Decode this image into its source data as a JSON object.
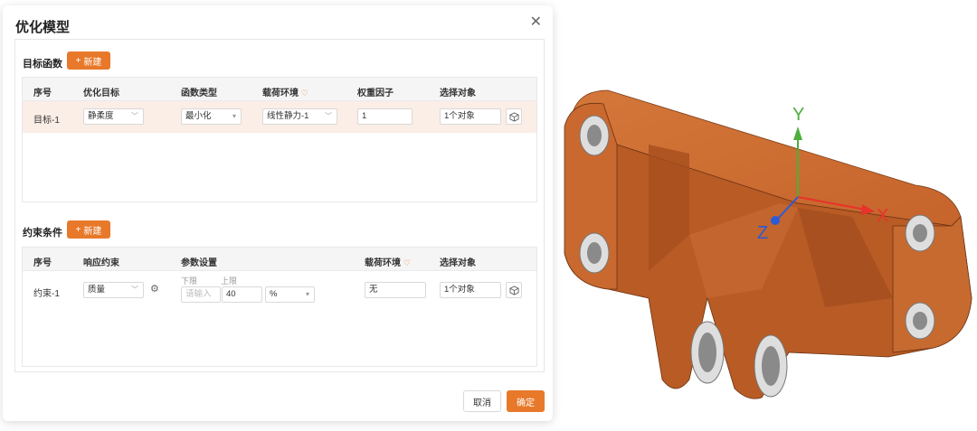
{
  "dialog": {
    "title": "优化模型",
    "close_icon": "close-icon"
  },
  "objective": {
    "section_label": "目标函数",
    "new_label": "新建",
    "headers": {
      "index": "序号",
      "target": "优化目标",
      "func_type": "函数类型",
      "load_env": "载荷环境",
      "weight": "权重因子",
      "select_obj": "选择对象"
    },
    "row": {
      "index": "目标-1",
      "target": "静柔度",
      "func_type": "最小化",
      "load_env": "线性静力-1",
      "weight": "1",
      "select_obj": "1个对象"
    }
  },
  "constraint": {
    "section_label": "约束条件",
    "new_label": "新建",
    "headers": {
      "index": "序号",
      "response": "响应约束",
      "params": "参数设置",
      "load_env": "载荷环境",
      "select_obj": "选择对象"
    },
    "row": {
      "index": "约束-1",
      "response": "质量",
      "lower_label": "下限",
      "upper_label": "上限",
      "lower_placeholder": "请输入",
      "upper_value": "40",
      "unit": "%",
      "load_env": "无",
      "select_obj": "1个对象"
    }
  },
  "footer": {
    "cancel_label": "取消",
    "ok_label": "确定"
  },
  "viewer": {
    "axis_x": "X",
    "axis_y": "Y",
    "axis_z": "Z",
    "colors": {
      "part": "#c8692e",
      "x_axis": "#e8322a",
      "y_axis": "#4caf3a",
      "z_axis": "#2b5bd7"
    }
  },
  "accent": "#e8792a"
}
